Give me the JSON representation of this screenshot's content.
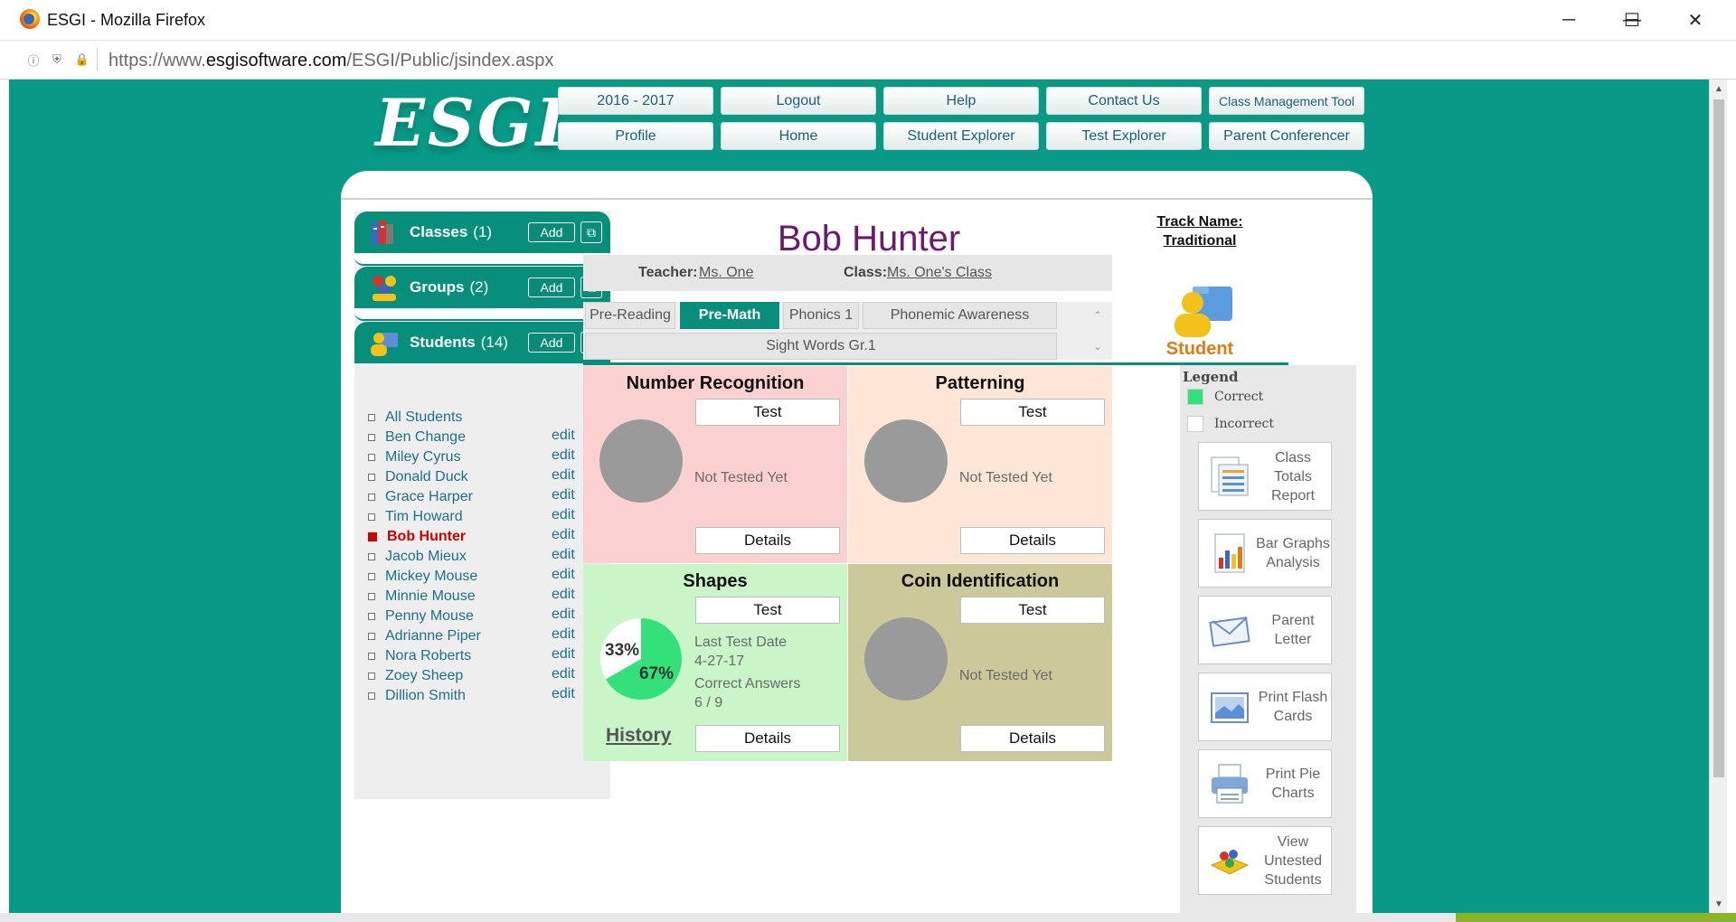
{
  "window": {
    "title": "ESGI - Mozilla Firefox",
    "url_prefix": "https://www.",
    "url_domain": "esgisoftware.com",
    "url_path": "/ESGI/Public/jsindex.aspx"
  },
  "app": {
    "logo": "ESGI",
    "nav": {
      "year": "2016 - 2017",
      "logout": "Logout",
      "help": "Help",
      "contact": "Contact Us",
      "class_mgmt": "Class Management Tool",
      "profile": "Profile",
      "home": "Home",
      "student_explorer": "Student Explorer",
      "test_explorer": "Test Explorer",
      "parent_conferencer": "Parent Conferencer"
    }
  },
  "sidebar": {
    "classes": {
      "title": "Classes",
      "count": "(1)",
      "add": "Add"
    },
    "groups": {
      "title": "Groups",
      "count": "(2)",
      "add": "Add"
    },
    "students": {
      "title": "Students",
      "count": "(14)",
      "add": "Add"
    },
    "all_students": "All Students",
    "edit_label": "edit",
    "list": [
      "Ben Change",
      "Miley Cyrus",
      "Donald Duck",
      "Grace Harper",
      "Tim Howard",
      "Bob Hunter",
      "Jacob Mieux",
      "Mickey Mouse",
      "Minnie Mouse",
      "Penny Mouse",
      "Adrianne Piper",
      "Nora Roberts",
      "Zoey Sheep",
      "Dillion Smith"
    ],
    "selected": "Bob Hunter"
  },
  "student": {
    "name": "Bob Hunter",
    "teacher_label": "Teacher:",
    "teacher": "Ms. One",
    "class_label": "Class:",
    "class": "Ms. One's Class"
  },
  "tabs": {
    "pre_reading": "Pre-Reading",
    "pre_math": "Pre-Math",
    "phonics": "Phonics 1",
    "phonemic": "Phonemic Awareness",
    "sight_words": "Sight Words Gr.1",
    "active": "Pre-Math"
  },
  "cards": {
    "test_label": "Test",
    "details_label": "Details",
    "not_tested": "Not Tested Yet",
    "number_recognition": {
      "title": "Number Recognition",
      "color": "#fbd0d0"
    },
    "patterning": {
      "title": "Patterning",
      "color": "#fde6d5"
    },
    "shapes": {
      "title": "Shapes",
      "color": "#c9f5c9",
      "incorrect_pct": "33%",
      "correct_pct": "67%",
      "last_test_label": "Last Test Date",
      "last_test_date": "4-27-17",
      "correct_label": "Correct Answers",
      "correct_value": "6 / 9",
      "history": "History"
    },
    "coin_identification": {
      "title": "Coin Identification",
      "color": "#cbc99a"
    }
  },
  "right": {
    "track_line1": "Track Name:",
    "track_line2": "Traditional",
    "student_label": "Student",
    "legend_title": "Legend",
    "legend_correct": "Correct",
    "legend_incorrect": "Incorrect",
    "correct_color": "#33e07a",
    "reports": [
      "Class Totals Report",
      "Bar Graphs Analysis",
      "Parent Letter",
      "Print Flash Cards",
      "Print Pie Charts",
      "View Untested Students"
    ]
  },
  "colors": {
    "brand_teal": "#089a86",
    "selected_red": "#d10000",
    "title_purple": "#6b1a6e",
    "student_orange": "#e07b13"
  }
}
